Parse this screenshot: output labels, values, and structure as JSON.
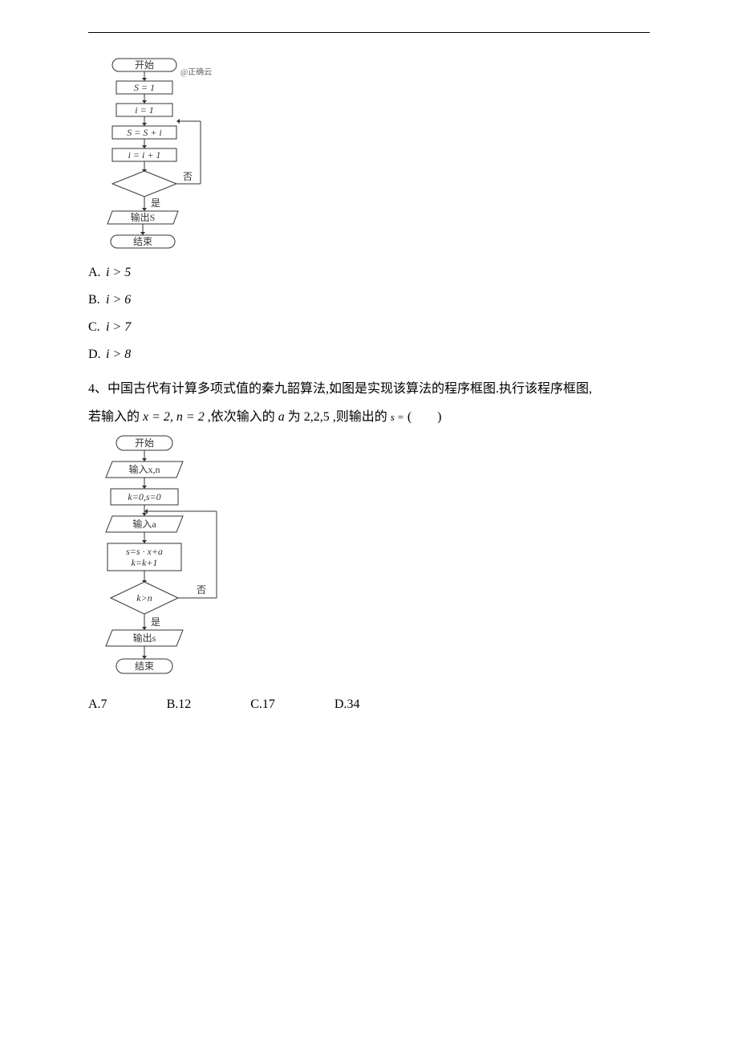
{
  "q3": {
    "flow": {
      "start": "开始",
      "watermark": "@正确云",
      "a1": "S = 1",
      "a2": "i = 1",
      "a3": "S = S + i",
      "a4": "i = i + 1",
      "no": "否",
      "yes": "是",
      "out": "输出S",
      "end": "结束"
    },
    "options": {
      "A_label": "A.",
      "A_expr": "i > 5",
      "B_label": "B.",
      "B_expr": "i > 6",
      "C_label": "C.",
      "C_expr": "i > 7",
      "D_label": "D.",
      "D_expr": "i > 8"
    }
  },
  "q4": {
    "text_line1": "4、中国古代有计算多项式值的秦九韶算法,如图是实现该算法的程序框图.执行该程序框图,",
    "text_line2_a": "若输入的 ",
    "text_line2_b": " ,依次输入的 ",
    "text_line2_c": " 为 2,2,5 ,则输出的 ",
    "text_line2_d": " (　　)",
    "eq1": "x = 2, n = 2",
    "a_var": "a",
    "s_eq": "s =",
    "flow": {
      "start": "开始",
      "in1": "输入x,n",
      "a1": "k=0,s=0",
      "in2": "输入a",
      "a2a": "s=s · x+a",
      "a2b": "k=k+1",
      "cond": "k>n",
      "no": "否",
      "yes": "是",
      "out": "输出s",
      "end": "结束"
    },
    "options": {
      "A": "A.7",
      "B": "B.12",
      "C": "C.17",
      "D": "D.34"
    }
  }
}
